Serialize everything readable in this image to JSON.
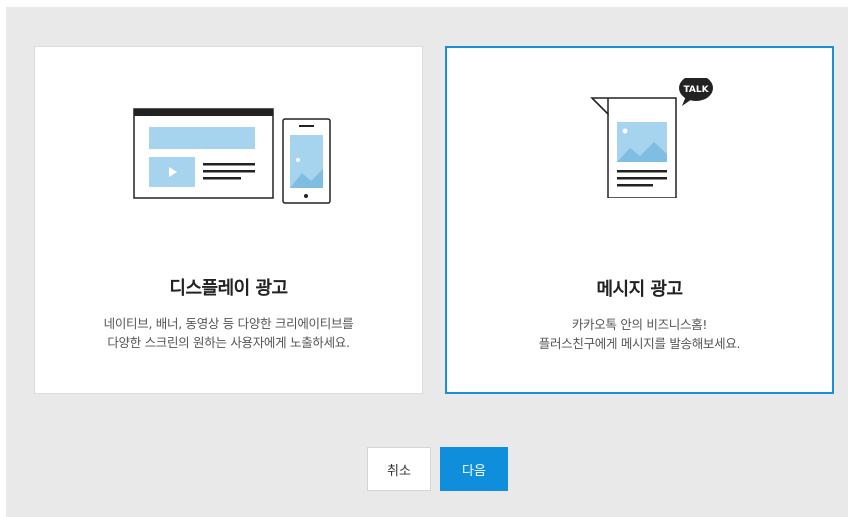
{
  "cards": [
    {
      "title": "디스플레이 광고",
      "desc_line1": "네이티브, 배너, 동영상 등 다양한 크리에이티브를",
      "desc_line2": "다양한 스크린의 원하는 사용자에게 노출하세요.",
      "selected": false
    },
    {
      "title": "메시지 광고",
      "desc_line1": "카카오톡 안의 비즈니스홈!",
      "desc_line2": "플러스친구에게 메시지를 발송해보세요.",
      "badge": "TALK",
      "selected": true
    }
  ],
  "buttons": {
    "cancel_label": "취소",
    "next_label": "다음"
  },
  "colors": {
    "accent": "#0f8fdb",
    "selected_border": "#1a8fd6",
    "illustration_blue": "#a6d3ee",
    "backdrop": "#e9e9e9"
  }
}
